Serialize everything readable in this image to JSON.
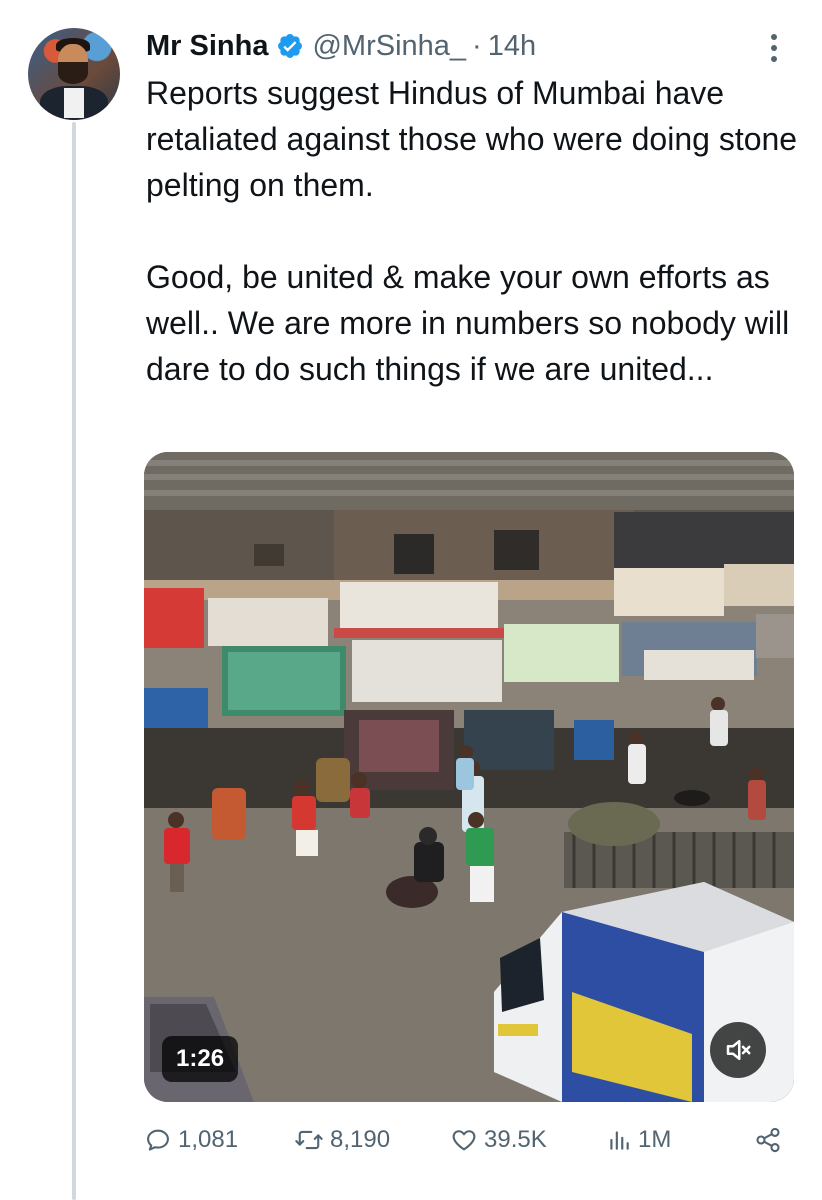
{
  "tweet": {
    "author_name": "Mr Sinha",
    "handle": "@MrSinha_",
    "separator": "·",
    "time": "14h",
    "paragraph_1": "Reports suggest Hindus of Mumbai have retaliated against those who were doing stone pelting on them.",
    "paragraph_2": "Good, be united & make your own efforts as well.. We are more in numbers so nobody will dare to do such things if we are united...",
    "verified_color": "#1d9bf0"
  },
  "media": {
    "duration": "1:26",
    "mute_icon": "speaker-muted-icon"
  },
  "actions": {
    "replies": "1,081",
    "reposts": "8,190",
    "likes": "39.5K",
    "views": "1M"
  },
  "colors": {
    "text_primary": "#0f1419",
    "text_secondary": "#536471",
    "thread_line": "#cfd9de"
  }
}
